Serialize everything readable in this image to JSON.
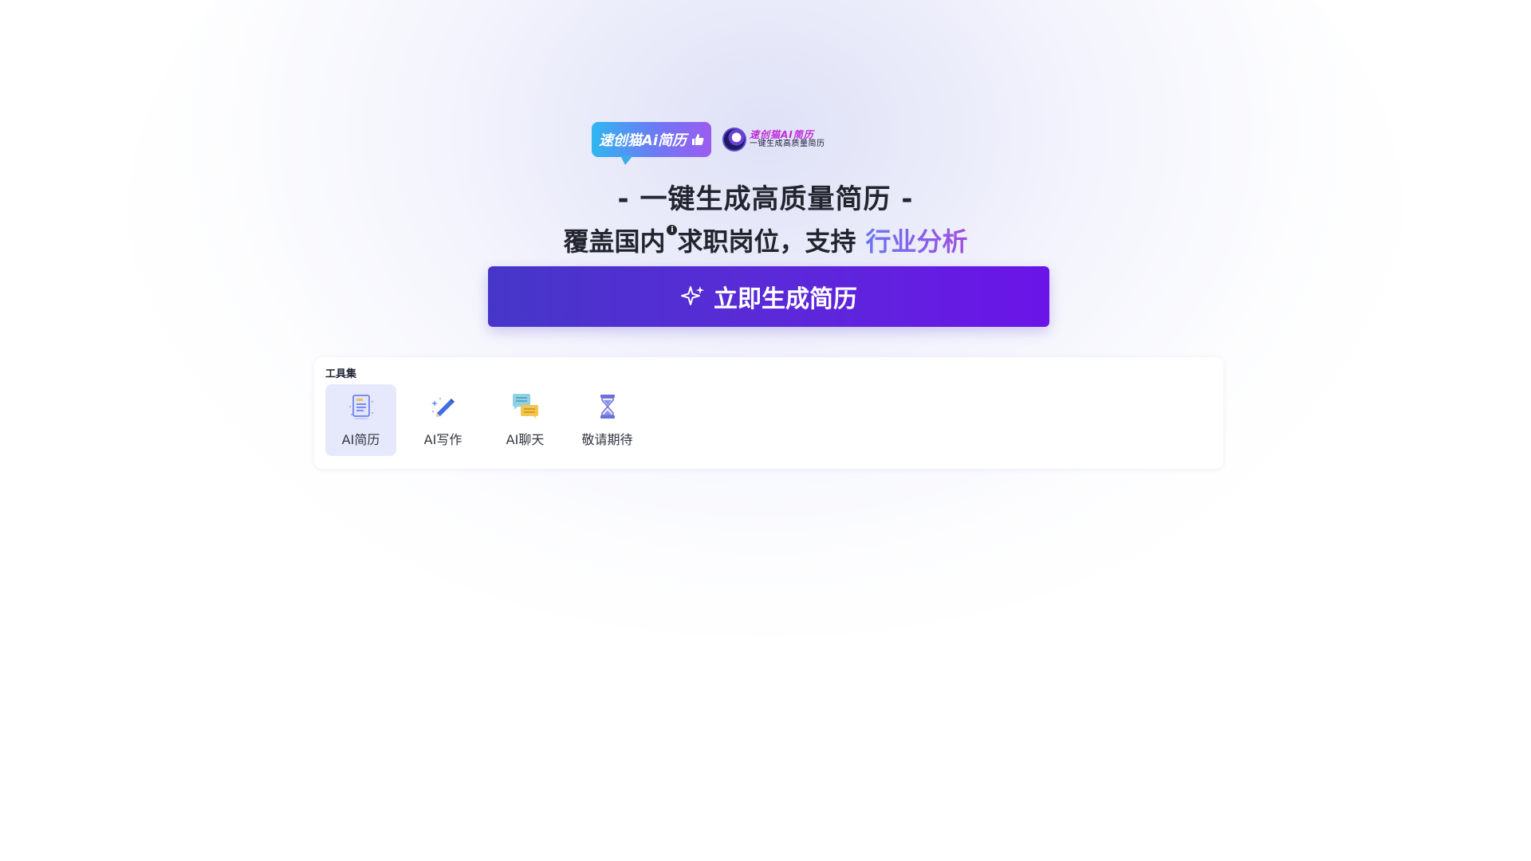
{
  "brand": {
    "bubble_text": "速创猫Ai简历",
    "logo_title": "速创猫AI简历",
    "logo_sub": "一键生成高质量简历"
  },
  "hero": {
    "headline": "- 一键生成高质量简历 -",
    "subline_prefix": "覆盖国内",
    "sup": "i",
    "subline_mid": "求职岗位，支持",
    "subline_highlight": "行业分析",
    "cta_label": "立即生成简历"
  },
  "toolbox": {
    "title": "工具集",
    "items": [
      {
        "label": "AI简历",
        "icon": "resume-icon",
        "active": true
      },
      {
        "label": "AI写作",
        "icon": "pencil-icon",
        "active": false
      },
      {
        "label": "AI聊天",
        "icon": "chat-icon",
        "active": false
      },
      {
        "label": "敬请期待",
        "icon": "hourglass-icon",
        "active": false
      }
    ]
  },
  "colors": {
    "accent_start": "#4636c8",
    "accent_end": "#6b14e8",
    "highlight_start": "#6a74f0",
    "highlight_end": "#a24ee0"
  }
}
